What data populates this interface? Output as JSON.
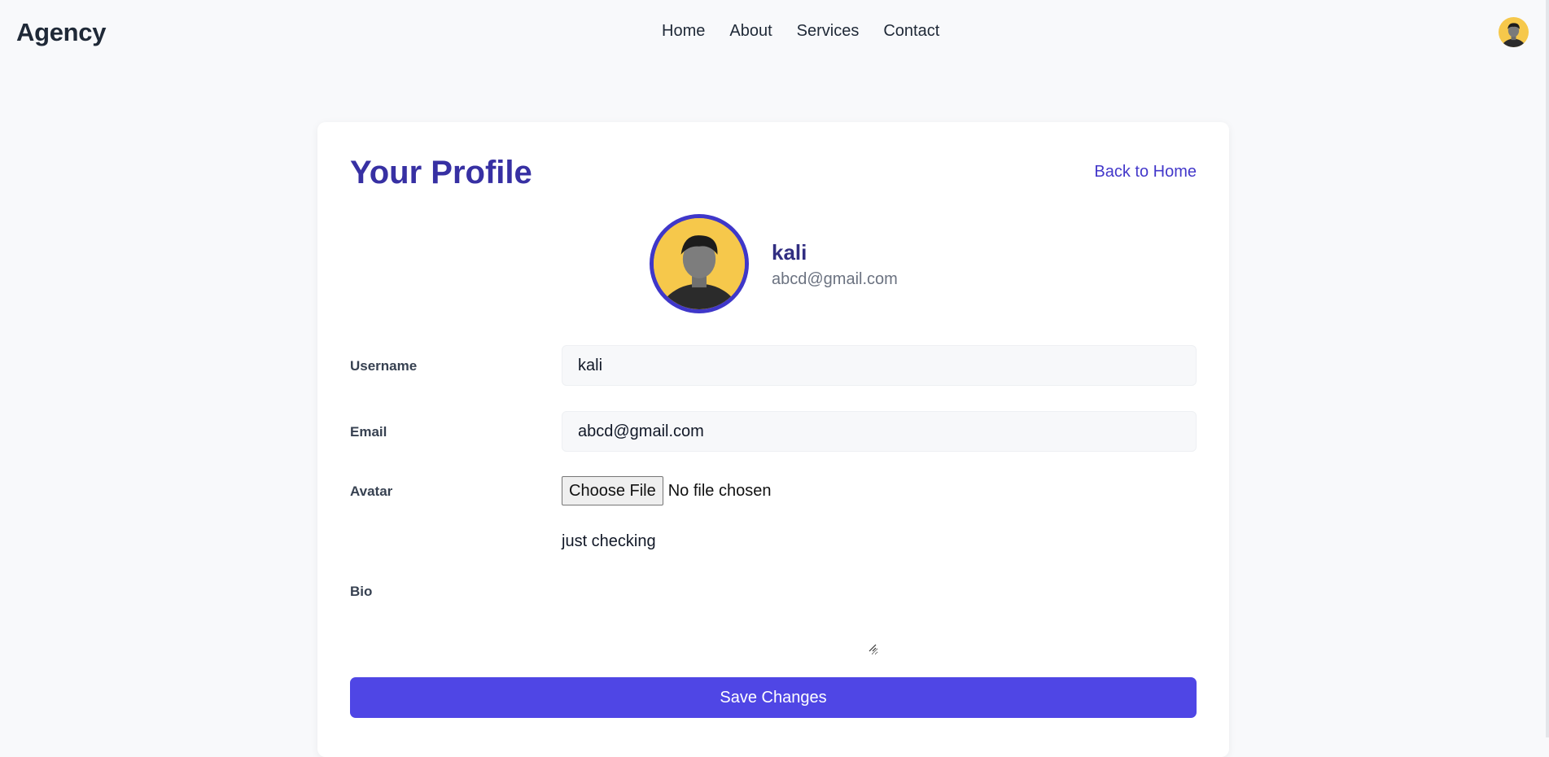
{
  "header": {
    "brand": "Agency",
    "nav": [
      {
        "label": "Home"
      },
      {
        "label": "About"
      },
      {
        "label": "Services"
      },
      {
        "label": "Contact"
      }
    ]
  },
  "profile": {
    "title": "Your Profile",
    "back_link": "Back to Home",
    "name": "kali",
    "email": "abcd@gmail.com"
  },
  "form": {
    "username_label": "Username",
    "username_value": "kali",
    "email_label": "Email",
    "email_value": "abcd@gmail.com",
    "avatar_label": "Avatar",
    "file_button": "Choose File",
    "file_status": "No file chosen",
    "bio_label": "Bio",
    "bio_value": "just checking",
    "save_label": "Save Changes"
  },
  "colors": {
    "accent": "#4f46e5",
    "title": "#3730a3",
    "avatar_ring": "#3f37c9",
    "avatar_bg": "#f6c84b"
  }
}
